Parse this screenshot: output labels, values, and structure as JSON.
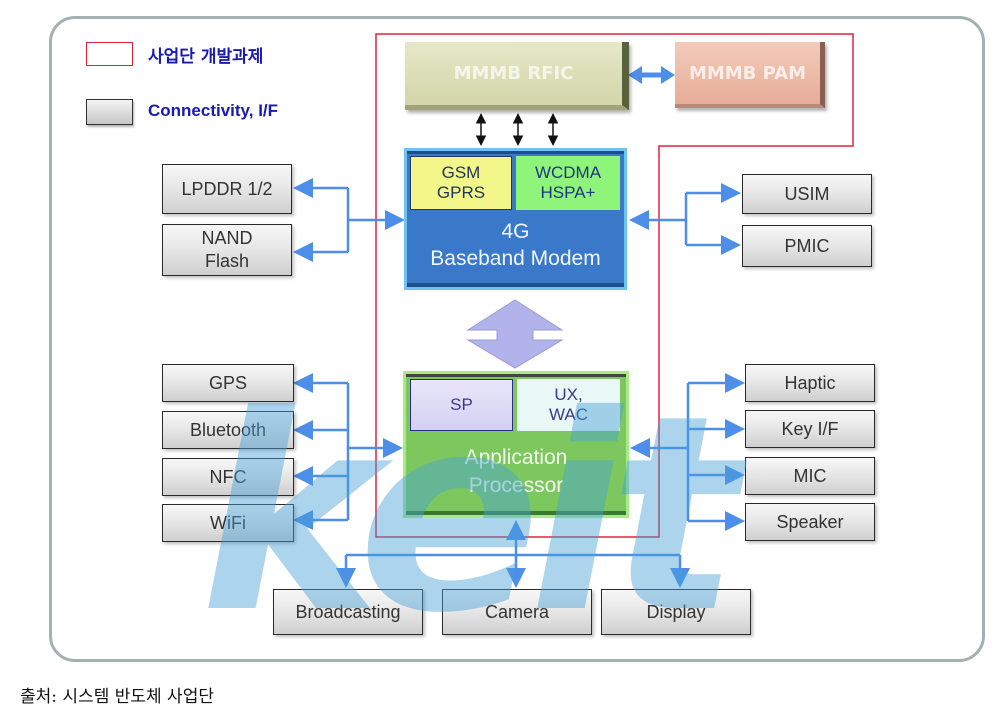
{
  "legend": {
    "project_label": "사업단 개발과제",
    "connectivity_label": "Connectivity, I/F"
  },
  "rf": {
    "rfic": "MMMB RFIC",
    "pam": "MMMB PAM"
  },
  "modem": {
    "sub_left": [
      "GSM",
      "GPRS"
    ],
    "sub_right": [
      "WCDMA",
      "HSPA+"
    ],
    "title": [
      "4G",
      "Baseband Modem"
    ]
  },
  "ap": {
    "sub_left": "SP",
    "sub_right": [
      "UX,",
      "WAC"
    ],
    "title": [
      "Application",
      "Processor"
    ]
  },
  "left_modem_blocks": [
    "LPDDR 1/2",
    [
      "NAND",
      "Flash"
    ]
  ],
  "right_modem_blocks": [
    "USIM",
    "PMIC"
  ],
  "left_ap_blocks": [
    "GPS",
    "Bluetooth",
    "NFC",
    "WiFi"
  ],
  "right_ap_blocks": [
    "Haptic",
    "Key I/F",
    "MIC",
    "Speaker"
  ],
  "bottom_blocks": [
    "Broadcasting",
    "Camera",
    "Display"
  ],
  "watermark": "keit",
  "caption": "출처: 시스템 반도체 사업단",
  "colors": {
    "project_outline": "#e0233d",
    "connector": "#4d8fe8",
    "legend_text": "#1a1ab0",
    "modem": "#3a78c9",
    "ap": "#7cc85e"
  }
}
